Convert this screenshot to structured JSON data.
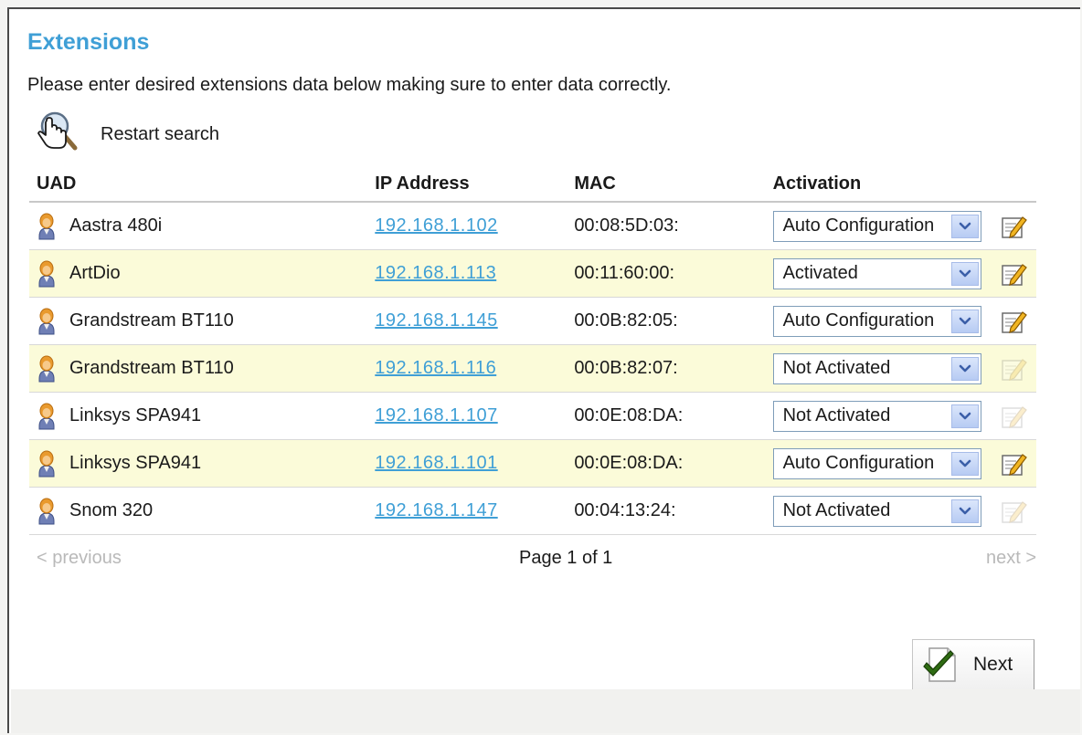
{
  "page": {
    "title": "Extensions",
    "intro": "Please enter desired extensions data below making sure to enter data correctly.",
    "restart_label": "Restart search"
  },
  "table": {
    "headers": [
      "UAD",
      "IP Address",
      "MAC",
      "Activation"
    ],
    "rows": [
      {
        "uad": "Aastra 480i",
        "ip": "192.168.1.102",
        "mac": "00:08:5D:03:",
        "activation": "Auto Configuration",
        "edit_enabled": true
      },
      {
        "uad": "ArtDio",
        "ip": "192.168.1.113",
        "mac": "00:11:60:00:",
        "activation": "Activated",
        "edit_enabled": true
      },
      {
        "uad": "Grandstream BT110",
        "ip": "192.168.1.145",
        "mac": "00:0B:82:05:",
        "activation": "Auto Configuration",
        "edit_enabled": true
      },
      {
        "uad": "Grandstream BT110",
        "ip": "192.168.1.116",
        "mac": "00:0B:82:07:",
        "activation": "Not Activated",
        "edit_enabled": false
      },
      {
        "uad": "Linksys SPA941",
        "ip": "192.168.1.107",
        "mac": "00:0E:08:DA:",
        "activation": "Not Activated",
        "edit_enabled": false
      },
      {
        "uad": "Linksys SPA941",
        "ip": "192.168.1.101",
        "mac": "00:0E:08:DA:",
        "activation": "Auto Configuration",
        "edit_enabled": true
      },
      {
        "uad": "Snom 320",
        "ip": "192.168.1.147",
        "mac": "00:04:13:24:",
        "activation": "Not Activated",
        "edit_enabled": false
      }
    ]
  },
  "pager": {
    "prev_label": "< previous",
    "page_info": "Page 1 of 1",
    "next_label": "next >"
  },
  "buttons": {
    "next_label": "Next"
  },
  "icons": {
    "restart": "hand-magnifier-icon",
    "uad": "person-icon",
    "dropdown": "chevron-down-icon",
    "edit": "edit-icon",
    "next": "checkmark-document-icon"
  },
  "colors": {
    "title": "#3f9fd6",
    "link": "#3f9fd6",
    "alt_row": "#fbfbd9",
    "disabled_text": "#b9b9b9"
  }
}
